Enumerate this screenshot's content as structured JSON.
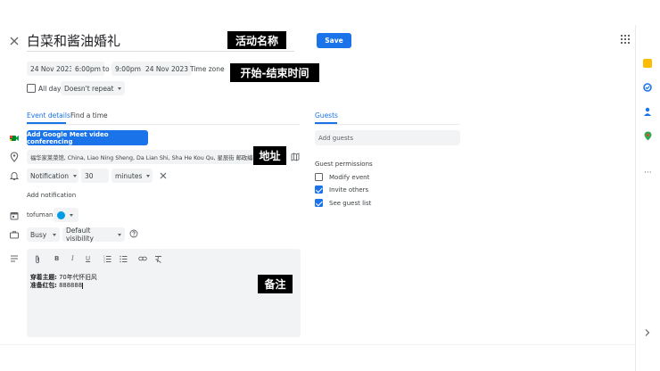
{
  "header": {
    "title": "白菜和酱油婚礼",
    "save_label": "Save",
    "annot_title": "活动名称"
  },
  "datetime": {
    "start_date": "24 Nov 2023",
    "start_time": "6:00pm",
    "to": "to",
    "end_time": "9:00pm",
    "end_date": "24 Nov 2023",
    "timezone": "Time zone",
    "annot": "开始-结束时间",
    "allday_label": "All day",
    "repeat": "Doesn't repeat"
  },
  "tabs": {
    "event_details": "Event details",
    "find_time": "Find a time"
  },
  "details": {
    "meet_button": "Add Google Meet video conferencing",
    "location": "福华家莱菜馆, China, Liao Ning Sheng, Da Lian Shi, Sha He Kou Qu, 星辰街 邮政编码",
    "annot_location": "地址",
    "notif_type": "Notification",
    "notif_value": "30",
    "notif_unit": "minutes",
    "add_notification": "Add notification",
    "calendar_owner": "tofuman",
    "busy": "Busy",
    "visibility": "Default visibility"
  },
  "description": {
    "line1_label": "穿着主题:",
    "line1_value": "70年代怀旧风",
    "line2_label": "准备红包:",
    "line2_value": "888888",
    "annot": "备注"
  },
  "guests": {
    "tab": "Guests",
    "add_placeholder": "Add guests",
    "permissions_title": "Guest permissions",
    "perms": [
      {
        "label": "Modify event",
        "checked": false
      },
      {
        "label": "Invite others",
        "checked": true
      },
      {
        "label": "See guest list",
        "checked": true
      }
    ]
  },
  "colors": {
    "accent": "#1a73e8",
    "calendar_color": "#039be5"
  }
}
